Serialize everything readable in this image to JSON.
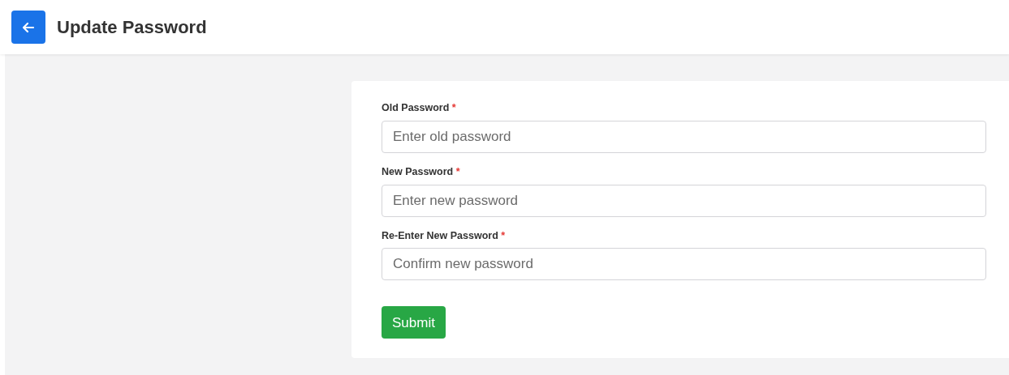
{
  "header": {
    "title": "Update Password"
  },
  "fields": [
    {
      "label": "Old Password",
      "required_mark": "*",
      "placeholder": "Enter old password"
    },
    {
      "label": "New Password",
      "required_mark": "*",
      "placeholder": "Enter new password"
    },
    {
      "label": "Re-Enter New Password",
      "required_mark": "*",
      "placeholder": "Confirm new password"
    }
  ],
  "submit": {
    "label": "Submit"
  }
}
